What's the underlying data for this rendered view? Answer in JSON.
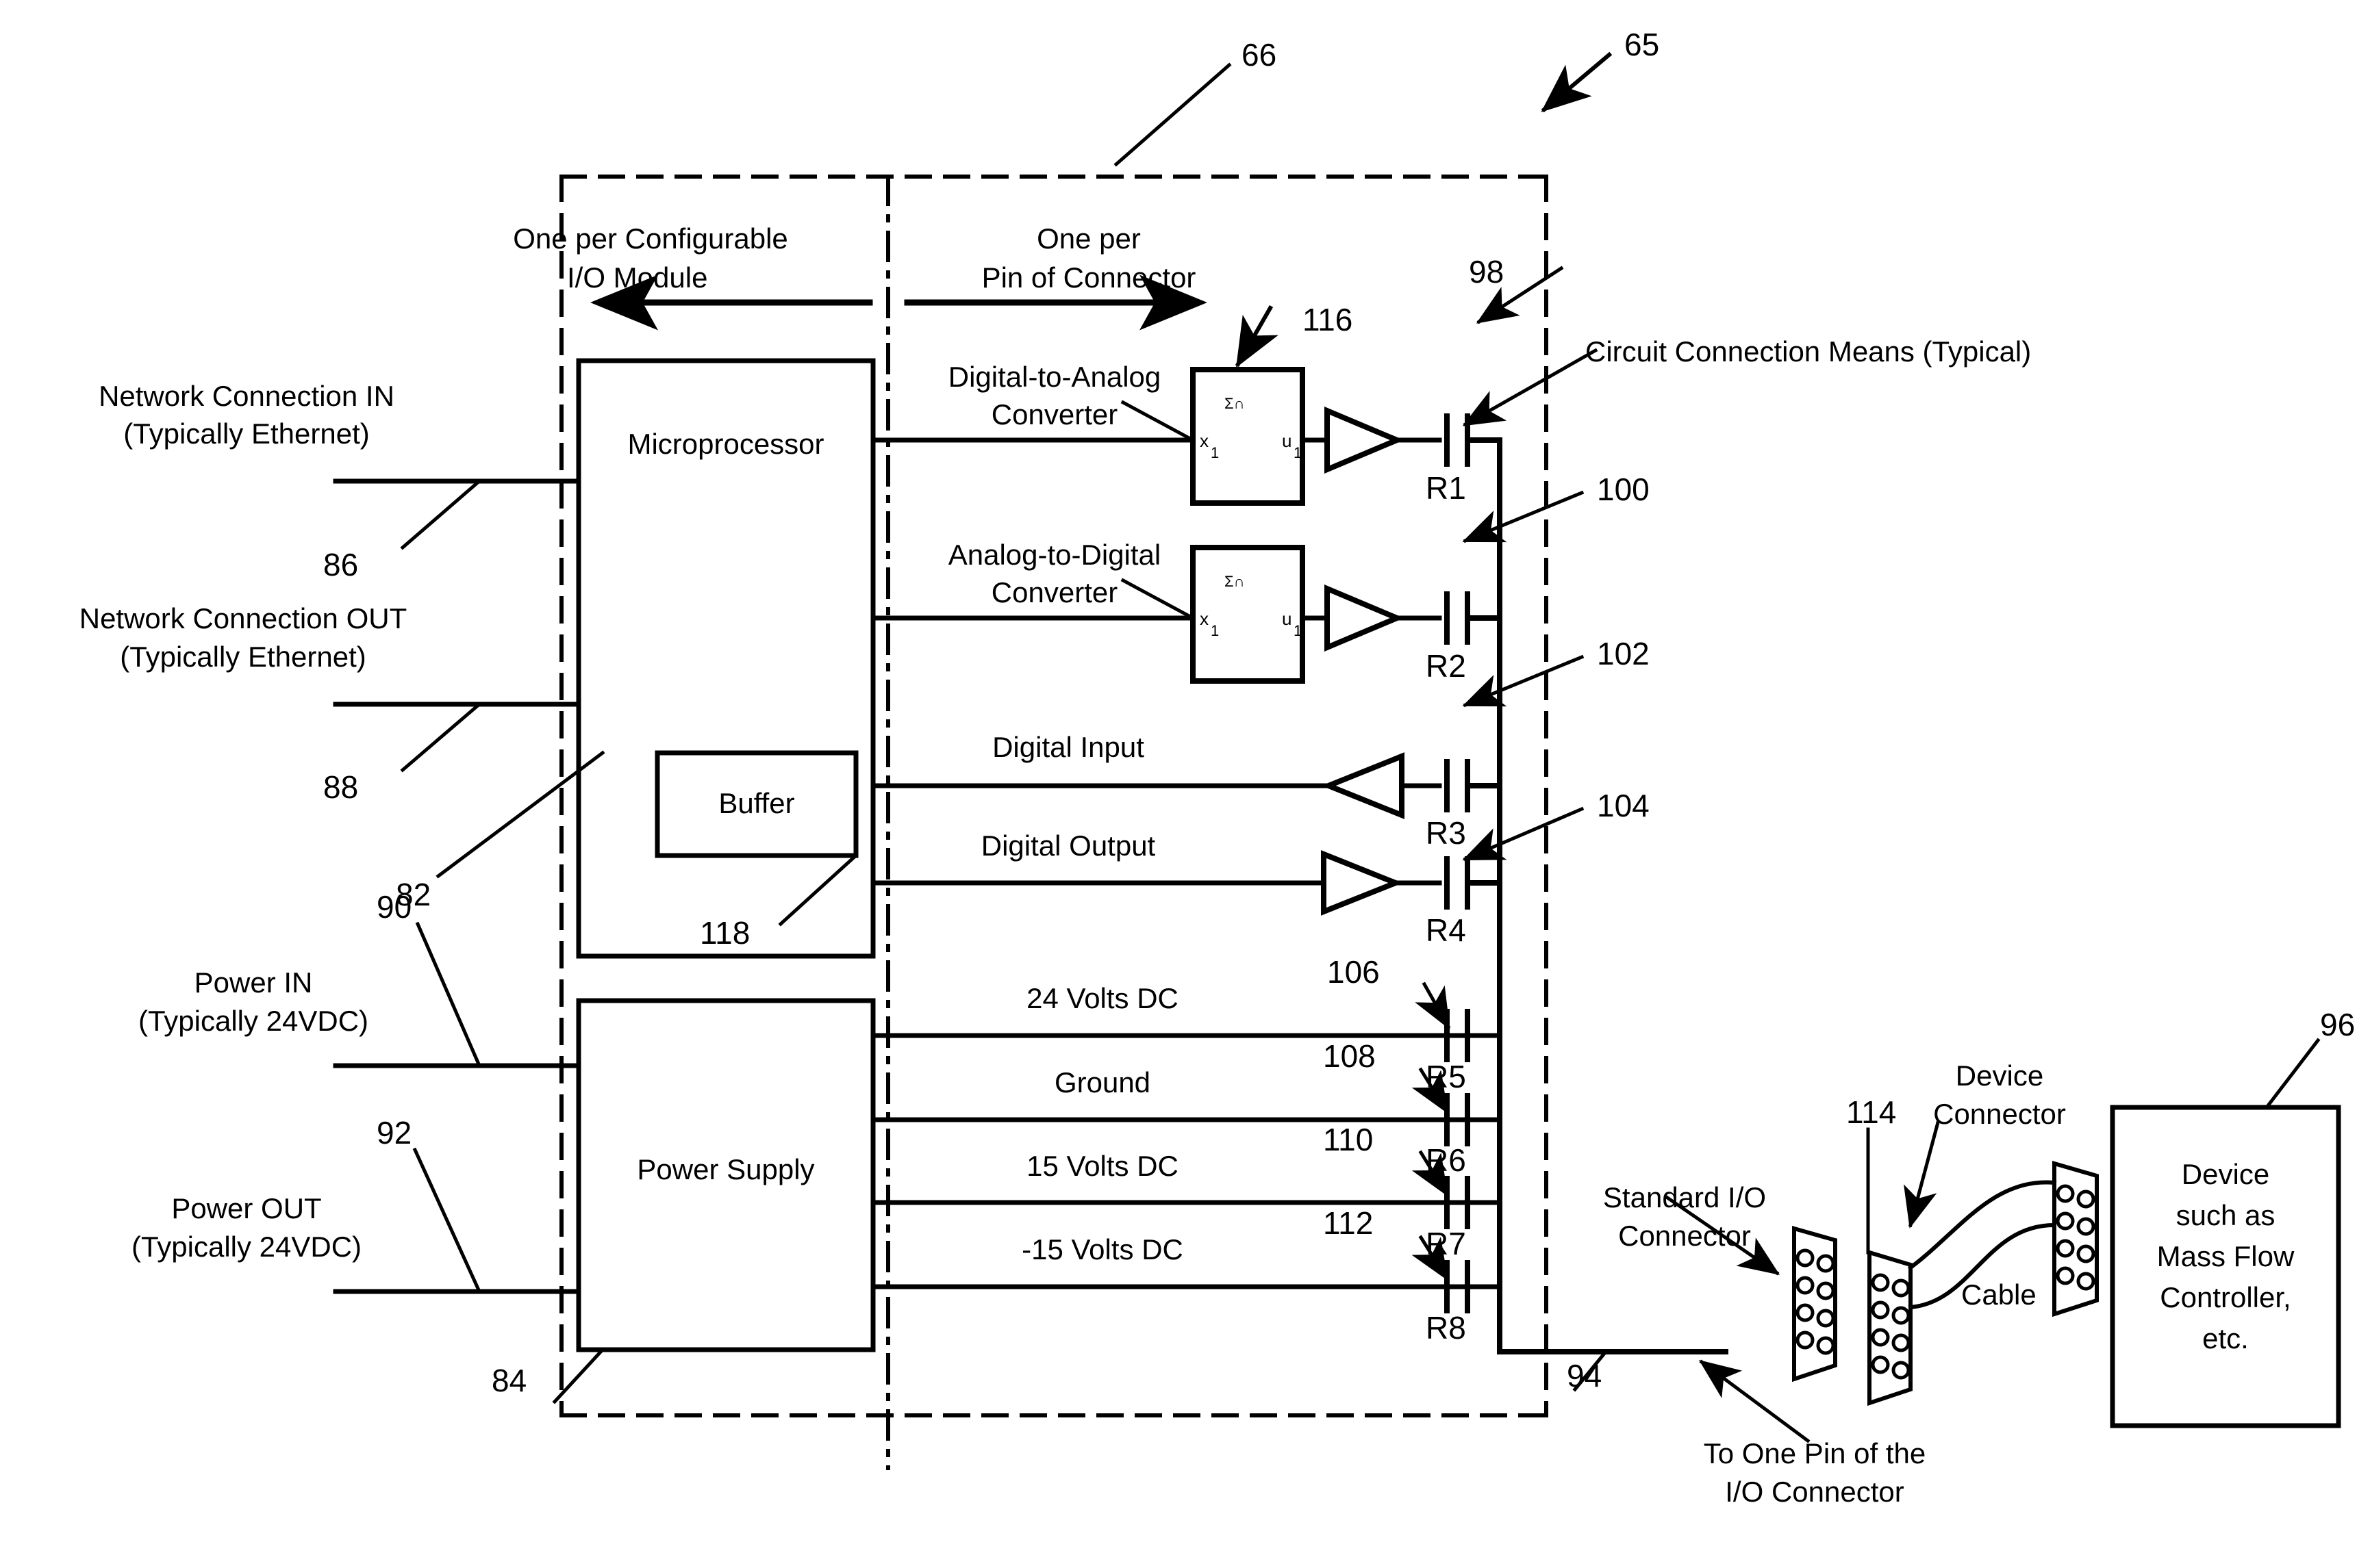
{
  "figure": {
    "title_refs": {
      "fig_ref_65": "65",
      "fig_ref_66": "66"
    },
    "regions": {
      "left_note_line1": "One per Configurable",
      "left_note_line2": "I/O Module",
      "right_note_line1": "One per",
      "right_note_line2": "Pin of Connector"
    },
    "left_ports": [
      {
        "line1": "Network Connection IN",
        "line2": "(Typically Ethernet)",
        "ref": "86"
      },
      {
        "line1": "Network Connection OUT",
        "line2": "(Typically Ethernet)",
        "ref": "88"
      },
      {
        "line1": "Power IN",
        "line2": "(Typically 24VDC)",
        "ref": "90"
      },
      {
        "line1": "Power OUT",
        "line2": "(Typically 24VDC)",
        "ref": "92"
      }
    ],
    "blocks": {
      "microprocessor": {
        "label": "Microprocessor",
        "ref": "82"
      },
      "buffer": {
        "label": "Buffer",
        "ref": "118"
      },
      "power_supply": {
        "label": "Power Supply",
        "ref": "84"
      },
      "device": {
        "line1": "Device",
        "line2": "such as",
        "line3": "Mass Flow",
        "line4": "Controller,",
        "line5": "etc.",
        "ref": "96"
      }
    },
    "converters": [
      {
        "label_line1": "Digital-to-Analog",
        "label_line2": "Converter",
        "in_pin": "x",
        "in_sub": "1",
        "out_pin": "u",
        "out_sub": "1",
        "inner": "Σ∩",
        "ref": "116"
      },
      {
        "label_line1": "Analog-to-Digital",
        "label_line2": "Converter",
        "in_pin": "x",
        "in_sub": "1",
        "out_pin": "u",
        "out_sub": "1",
        "inner": "Σ∩",
        "ref": ""
      }
    ],
    "signal_rows": [
      {
        "label": "Digital Input",
        "resistor": "R3",
        "ref": ""
      },
      {
        "label": "Digital Output",
        "resistor": "R4",
        "ref": ""
      }
    ],
    "power_rows": [
      {
        "label": "24 Volts DC",
        "resistor": "R5",
        "ref": "106"
      },
      {
        "label": "Ground",
        "resistor": "R6",
        "ref": "108"
      },
      {
        "label": "15 Volts DC",
        "resistor": "R7",
        "ref": "110"
      },
      {
        "label": "-15 Volts DC",
        "resistor": "R8",
        "ref": "112"
      }
    ],
    "converter_resistors": [
      {
        "resistor": "R1",
        "ref": ""
      },
      {
        "resistor": "R2",
        "ref": ""
      }
    ],
    "bus_refs": [
      {
        "ref": "98"
      },
      {
        "ref": "100"
      },
      {
        "ref": "102"
      },
      {
        "ref": "104"
      }
    ],
    "callouts": {
      "circuit_connection_means": "Circuit Connection Means (Typical)",
      "standard_io_connector_line1": "Standard I/O",
      "standard_io_connector_line2": "Connector",
      "standard_io_connector_ref": "94",
      "to_one_pin_line1": "To One Pin of the",
      "to_one_pin_line2": "I/O Connector",
      "device_connector_line1": "Device",
      "device_connector_line2": "Connector",
      "device_connector_ref": "114",
      "cable": "Cable"
    },
    "colors": {
      "ink": "#000000",
      "paper": "#ffffff"
    }
  }
}
